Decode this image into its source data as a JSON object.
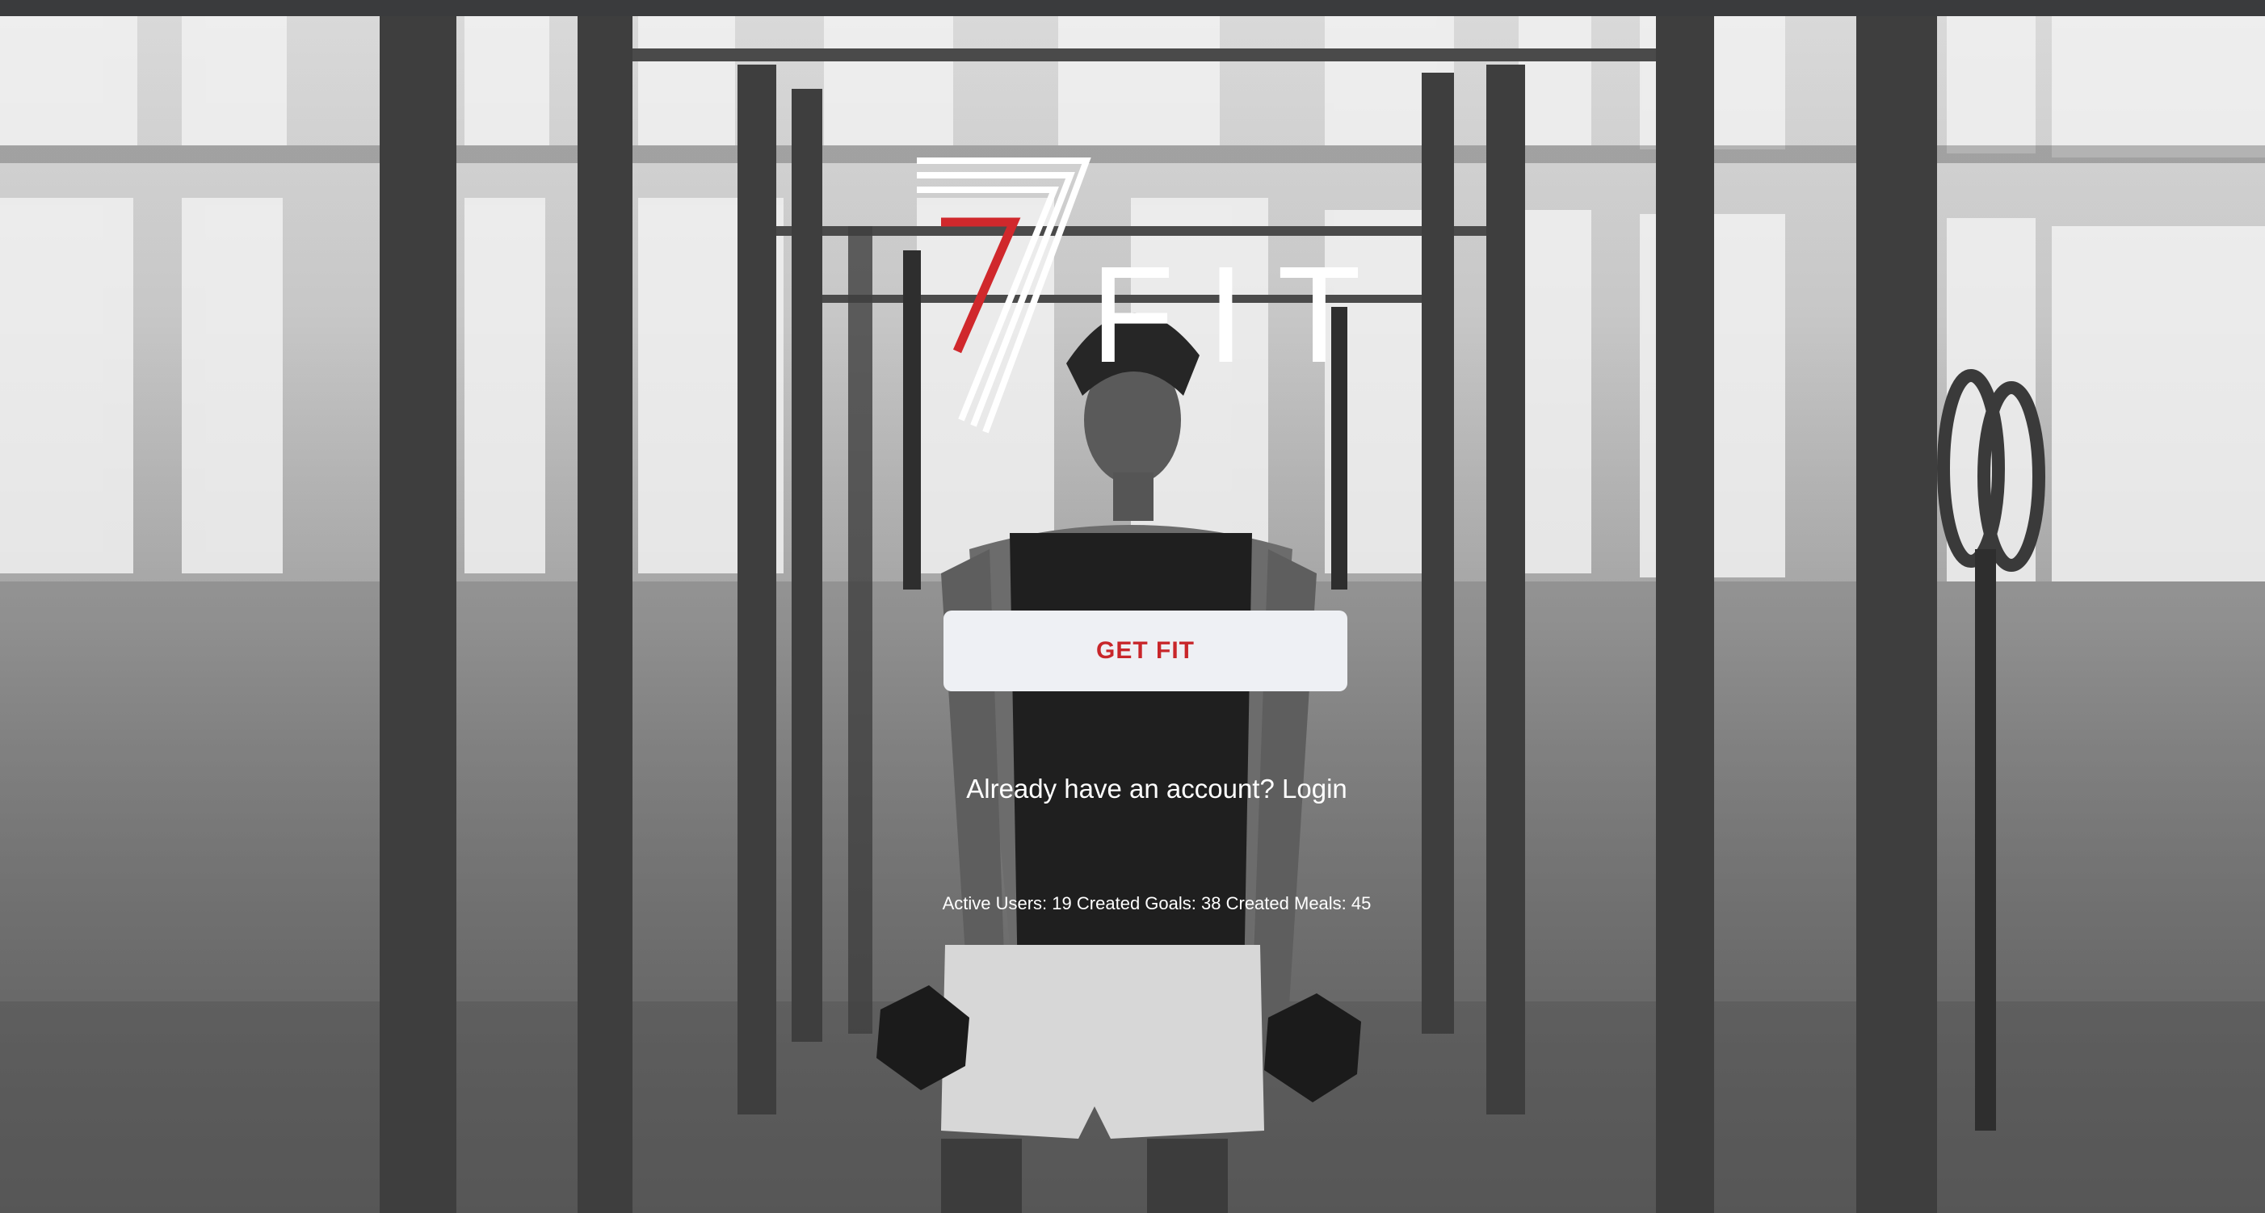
{
  "brand": {
    "logo_number": "7",
    "logo_word": "FIT",
    "accent_color": "#d0282c"
  },
  "cta": {
    "label": "GET FIT"
  },
  "login": {
    "prefix": "Already have an account?",
    "link_label": "Login"
  },
  "stats": {
    "active_users_label": "Active Users:",
    "active_users": "19",
    "created_goals_label": "Created Goals:",
    "created_goals": "38",
    "created_meals_label": "Created Meals:",
    "created_meals": "45"
  },
  "colors": {
    "button_bg": "#eef0f4",
    "button_text": "#c8262a",
    "topbar": "#3a3b3d"
  }
}
